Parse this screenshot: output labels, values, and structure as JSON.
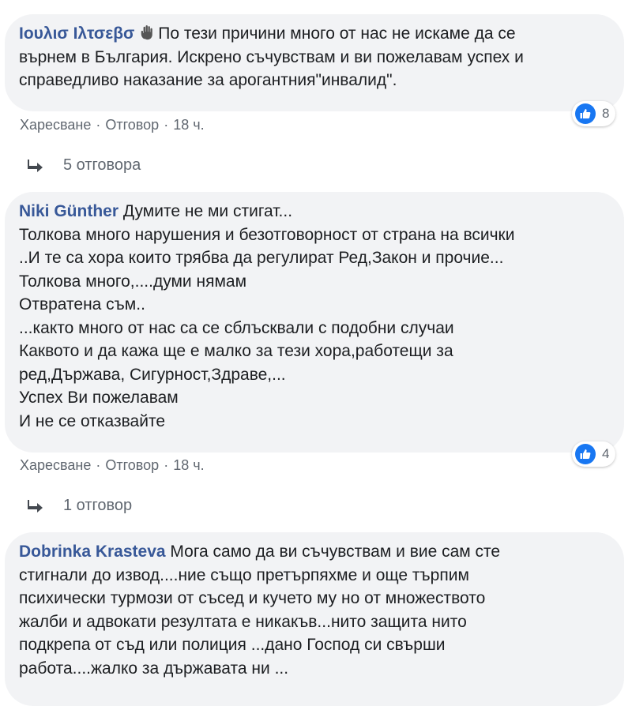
{
  "comments": [
    {
      "author": "Ιουλισ Ιλτσεβσ",
      "text": "По тези причини много от нас не искаме да се\nвърнем в България. Искрено съчувствам и ви пожелавам успех и\nсправедливо наказание за арогантния\"инвалид\".",
      "like_label": "Харесване",
      "reply_label": "Отговор",
      "time": "18 ч.",
      "reaction_count": "8",
      "replies_label": "5 отговора"
    },
    {
      "author": "Niki Günther",
      "text": "Думите не ми стигат...\nТолкова много нарушения и безотговорност от страна на всички\n..И те са хора които трябва да регулират Ред,Закон и прочие...\nТолкова много,....думи нямам\nОтвратена съм..\n...както много от нас са се сблъсквали с подобни случаи\nКаквото и да кажа ще е малко за тези хора,работещи за\nред,Държава, Сигурност,Здраве,...\nУспех Ви пожелавам\nИ не се отказвайте",
      "like_label": "Харесване",
      "reply_label": "Отговор",
      "time": "18 ч.",
      "reaction_count": "4",
      "replies_label": "1 отговор"
    },
    {
      "author": "Dobrinka Krasteva",
      "text": "Мога само да ви съчувствам и вие сам сте\nстигнали до извод....ние също претърпяхме и още търпим\nпсихически турмози от съсед и кучето му но от множеството\nжалби и адвокати резултата е никакъв...нито защита нито\nподкрепа от съд или полиция ...дано Господ си свърши\nработа....жалко за държавата ни ..."
    }
  ],
  "colors": {
    "author": "#385898",
    "bubble": "#f2f3f5",
    "meta": "#606770",
    "like_blue": "#1877f2"
  }
}
